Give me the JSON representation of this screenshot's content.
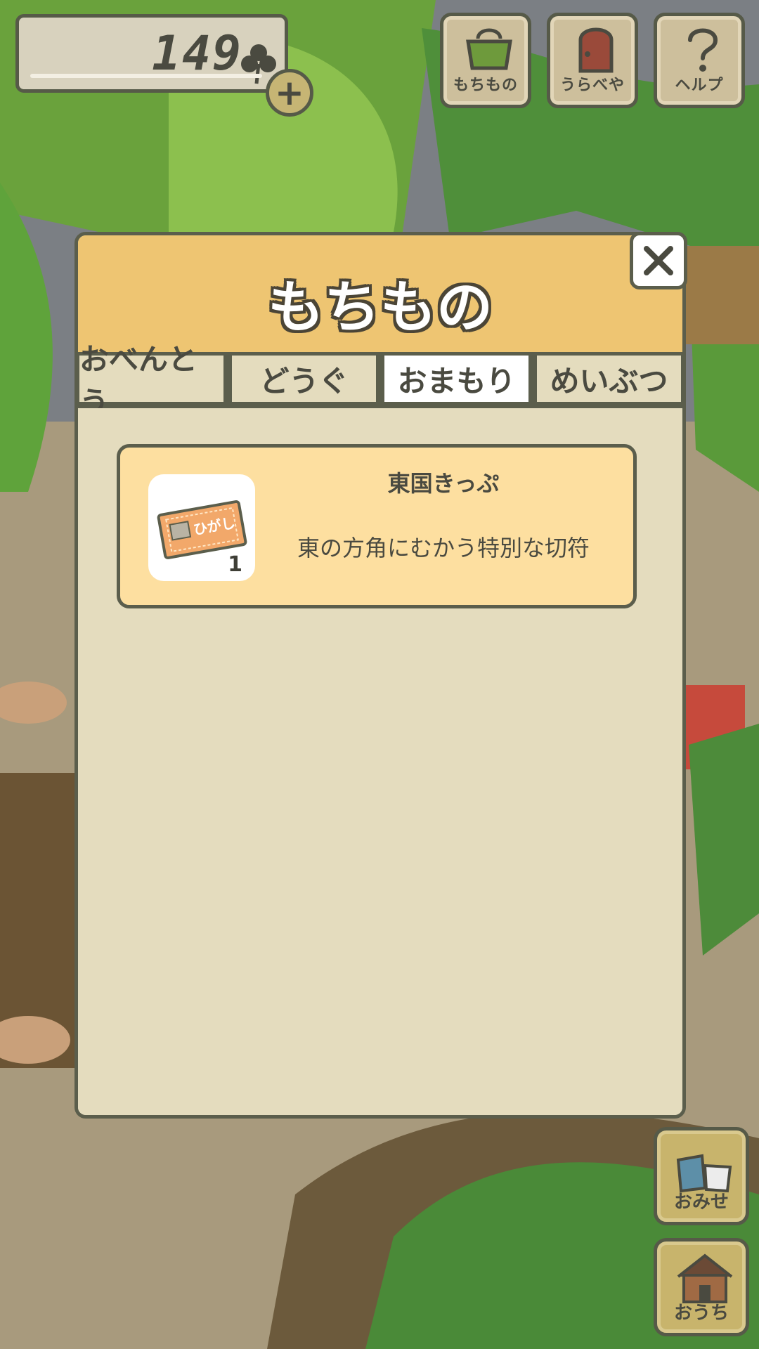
{
  "clover": {
    "count": "149",
    "icon": "clover-icon",
    "add_icon": "plus-icon"
  },
  "top_buttons": [
    {
      "label": "もちもの",
      "icon": "bag-icon"
    },
    {
      "label": "うらべや",
      "icon": "door-icon"
    },
    {
      "label": "ヘルプ",
      "icon": "question-icon"
    }
  ],
  "modal": {
    "title": "もちもの",
    "tabs": [
      {
        "label": "おべんとう",
        "active": false
      },
      {
        "label": "どうぐ",
        "active": false
      },
      {
        "label": "おまもり",
        "active": true
      },
      {
        "label": "めいぶつ",
        "active": false
      }
    ],
    "close_icon": "close-icon",
    "items": [
      {
        "name": "東国きっぷ",
        "description": "東の方角にむかう特別な切符",
        "quantity": "1",
        "ticket_text": "ひがし",
        "icon": "ticket-icon"
      }
    ]
  },
  "side_buttons": [
    {
      "label": "おみせ",
      "icon": "shop-bags-icon"
    },
    {
      "label": "おうち",
      "icon": "house-icon"
    }
  ],
  "colors": {
    "modal_header": "#eec572",
    "modal_body": "#e4dcbe",
    "card": "#fddfa0",
    "outline": "#5b5e4c"
  }
}
